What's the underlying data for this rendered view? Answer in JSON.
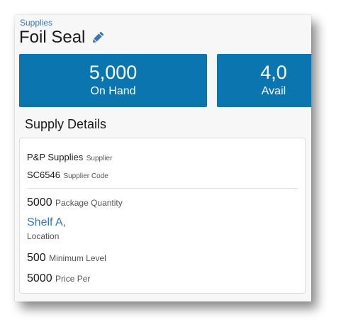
{
  "breadcrumb": "Supplies",
  "title": "Foil Seal",
  "icons": {
    "edit": "pencil-icon"
  },
  "colors": {
    "tile": "#0b75b0",
    "link": "#3a78b5"
  },
  "stats": [
    {
      "value": "5,000",
      "label": "On Hand"
    },
    {
      "value": "4,0",
      "label": "Avail"
    }
  ],
  "section_title": "Supply Details",
  "details": {
    "supplier": {
      "value": "P&P Supplies",
      "label": "Supplier"
    },
    "supplier_code": {
      "value": "SC6546",
      "label": "Supplier Code"
    },
    "package_quantity": {
      "value": "5000",
      "label": "Package Quantity"
    },
    "location": {
      "value": "Shelf A,",
      "label": "Location"
    },
    "minimum_level": {
      "value": "500",
      "label": "Minimum Level"
    },
    "price_per": {
      "value": "5000",
      "label": "Price Per"
    }
  }
}
